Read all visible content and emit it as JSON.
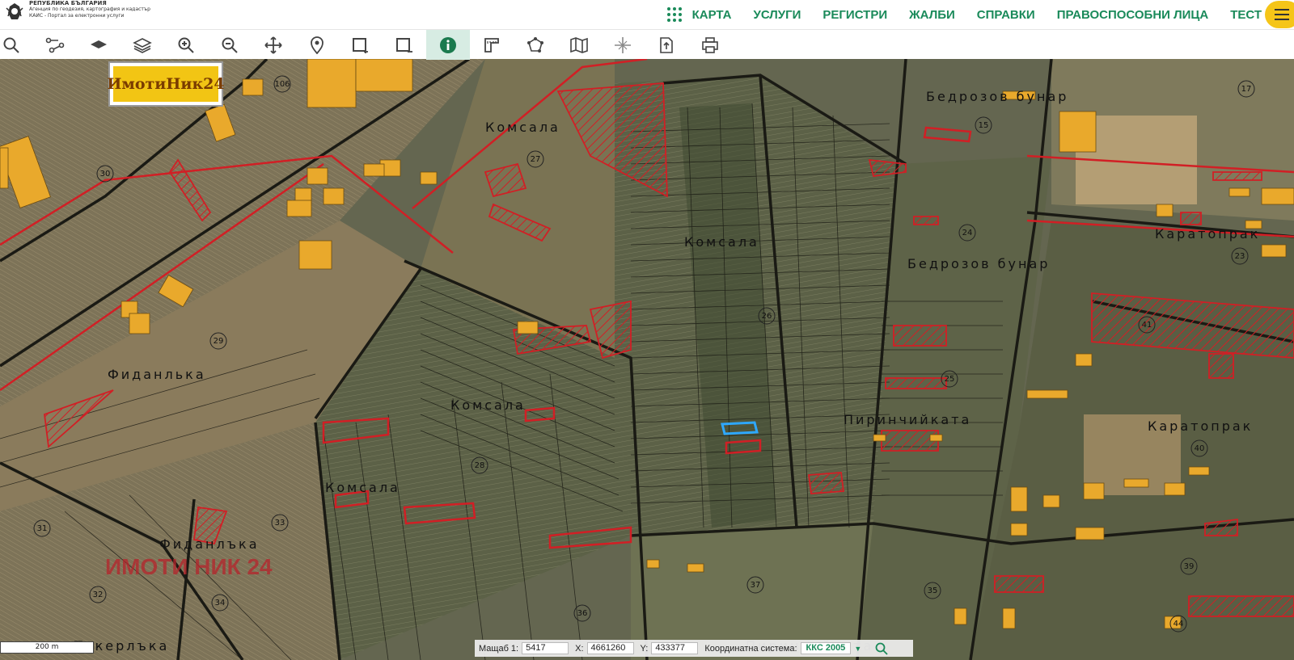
{
  "header": {
    "org_line1": "РЕПУБЛИКА БЪЛГАРИЯ",
    "org_line2": "Агенция по геодезия, картография и кадастър",
    "org_line3": "КАИС - Портал за електронни услуги",
    "nav": [
      "КАРТА",
      "УСЛУГИ",
      "РЕГИСТРИ",
      "ЖАЛБИ",
      "СПРАВКИ",
      "ПРАВОСПОСОБНИ ЛИЦА",
      "ТЕСТ"
    ]
  },
  "toolbar": {
    "tools": [
      "search-icon",
      "route-icon",
      "layer-icon",
      "layers-icon",
      "zoom-in-icon",
      "zoom-out-icon",
      "pan-icon",
      "location-pin-icon",
      "rectangle-select-icon",
      "rectangle-deselect-icon",
      "info-icon",
      "measure-icon",
      "polygon-icon",
      "map-icon",
      "crosshair-icon",
      "export-icon",
      "print-icon"
    ],
    "active_tool": "info-icon"
  },
  "map": {
    "watermark_logo": "ИмотиНик24",
    "watermark_text": "ИМОТИ НИК 24",
    "place_names": [
      "Комсала",
      "Комсала",
      "Комсала",
      "Комсала",
      "Фиданлька",
      "Фиданлъка",
      "Бедрозов бунар",
      "Бедрозов бунар",
      "Каратопрак",
      "Каратопрак",
      "Пиринчийката",
      "Текерлъка",
      "Пиринчийката"
    ],
    "parcel_numbers": [
      "106",
      "27",
      "30",
      "29",
      "28",
      "26",
      "24",
      "25",
      "15",
      "17",
      "23",
      "41",
      "40",
      "39",
      "44",
      "31",
      "32",
      "33",
      "34",
      "35",
      "36",
      "37"
    ]
  },
  "scale_label": "200 m",
  "coords": {
    "scale_label": "Мащаб 1:",
    "scale_value": "5417",
    "x_label": "X:",
    "x_value": "4661260",
    "y_label": "Y:",
    "y_value": "433377",
    "system_label": "Координатна система:",
    "system_value": "ККС 2005"
  },
  "colors": {
    "brand_green": "#1a8a5a",
    "accent_yellow": "#f5c518",
    "parcel_red": "#d11f25",
    "selected_parcel": "#2ea8ff",
    "building_orange": "#e9a92c"
  }
}
